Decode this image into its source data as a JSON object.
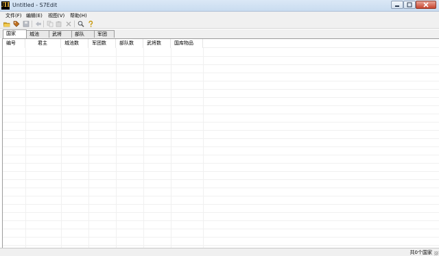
{
  "window": {
    "title": "Untitled - S7Edit",
    "app_icon_glyph": "ЛІ"
  },
  "menu": [
    {
      "label": "文件(F)"
    },
    {
      "label": "编辑(E)"
    },
    {
      "label": "视图(V)"
    },
    {
      "label": "帮助(H)"
    }
  ],
  "toolbar": [
    {
      "icon": "open-folder-icon"
    },
    {
      "icon": "tag-icon"
    },
    {
      "icon": "save-icon"
    },
    {
      "icon": "back-arrow-icon"
    },
    {
      "icon": "copy-icon"
    },
    {
      "icon": "paste-icon"
    },
    {
      "icon": "delete-icon"
    },
    {
      "icon": "find-icon"
    },
    {
      "icon": "help-icon"
    }
  ],
  "tabs": [
    {
      "label": "国家",
      "active": true
    },
    {
      "label": "城池"
    },
    {
      "label": "武将"
    },
    {
      "label": "部队"
    },
    {
      "label": "军团"
    }
  ],
  "table": {
    "columns": [
      "编号",
      "君主",
      "城池数",
      "军团数",
      "部队数",
      "武将数",
      "国库物品"
    ],
    "rows": []
  },
  "status": {
    "text": "共0个国家"
  },
  "colors": {
    "titlebar": "#c9dcf0",
    "chrome": "#f0f0f0",
    "close_button": "#c6452f"
  }
}
